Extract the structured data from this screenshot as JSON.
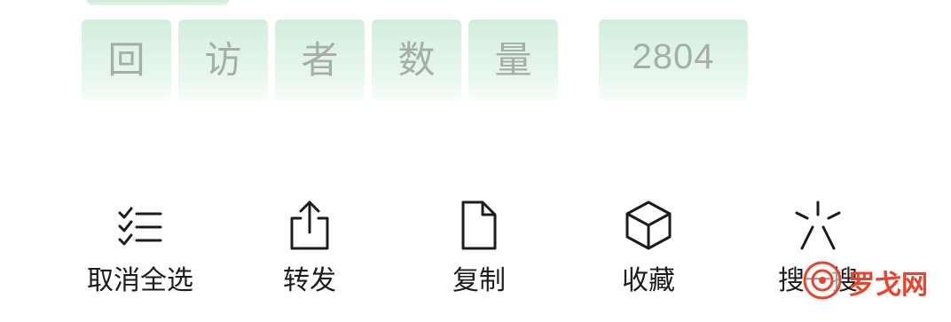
{
  "counter_tiles": [
    "回",
    "访",
    "者",
    "数",
    "量"
  ],
  "visitor_count": "2804",
  "actions": [
    {
      "label": "取消全选",
      "icon": "checklist-icon"
    },
    {
      "label": "转发",
      "icon": "share-icon"
    },
    {
      "label": "复制",
      "icon": "document-icon"
    },
    {
      "label": "收藏",
      "icon": "cube-icon"
    },
    {
      "label": "搜一搜",
      "icon": "sparkle-icon"
    }
  ],
  "watermark": {
    "text": "罗戈网",
    "color": "#e8452c"
  }
}
